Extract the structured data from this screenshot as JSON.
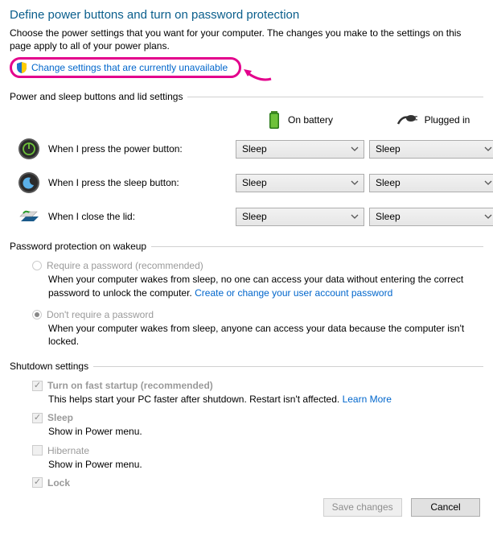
{
  "title": "Define power buttons and turn on password protection",
  "intro": "Choose the power settings that you want for your computer. The changes you make to the settings on this page apply to all of your power plans.",
  "change_link": "Change settings that are currently unavailable",
  "section_power": {
    "header": "Power and sleep buttons and lid settings",
    "col_battery": "On battery",
    "col_plugged": "Plugged in",
    "rows": [
      {
        "label": "When I press the power button:",
        "battery": "Sleep",
        "plugged": "Sleep"
      },
      {
        "label": "When I press the sleep button:",
        "battery": "Sleep",
        "plugged": "Sleep"
      },
      {
        "label": "When I close the lid:",
        "battery": "Sleep",
        "plugged": "Sleep"
      }
    ]
  },
  "section_password": {
    "header": "Password protection on wakeup",
    "require": {
      "label": "Require a password (recommended)",
      "desc_pre": "When your computer wakes from sleep, no one can access your data without entering the correct password to unlock the computer. ",
      "link": "Create or change your user account password"
    },
    "dont": {
      "label": "Don't require a password",
      "desc": "When your computer wakes from sleep, anyone can access your data because the computer isn't locked."
    }
  },
  "section_shutdown": {
    "header": "Shutdown settings",
    "items": [
      {
        "label": "Turn on fast startup (recommended)",
        "bold": true,
        "checked": true,
        "desc_pre": "This helps start your PC faster after shutdown. Restart isn't affected. ",
        "link": "Learn More"
      },
      {
        "label": "Sleep",
        "bold": true,
        "checked": true,
        "desc": "Show in Power menu."
      },
      {
        "label": "Hibernate",
        "bold": false,
        "checked": false,
        "desc": "Show in Power menu."
      },
      {
        "label": "Lock",
        "bold": true,
        "checked": true,
        "desc": ""
      }
    ]
  },
  "buttons": {
    "save": "Save changes",
    "cancel": "Cancel"
  }
}
